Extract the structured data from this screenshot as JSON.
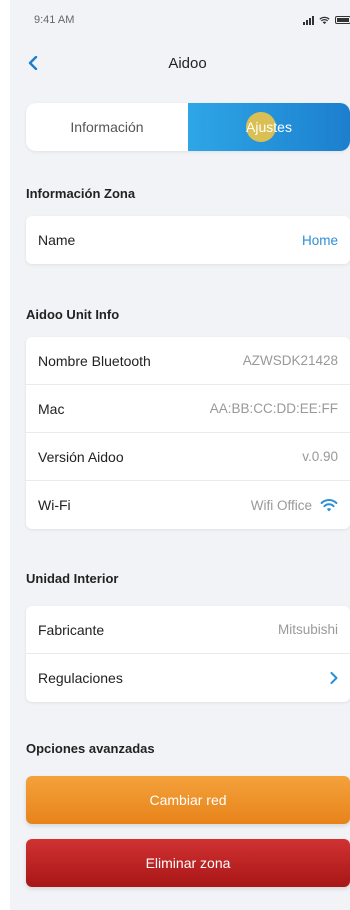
{
  "status_bar": {
    "time": "9:41 AM"
  },
  "nav": {
    "title": "Aidoo"
  },
  "tabs": [
    {
      "label": "Información",
      "active": false
    },
    {
      "label": "Ajustes",
      "active": true
    }
  ],
  "zona": {
    "title": "Información Zona",
    "rows": [
      {
        "label": "Name",
        "value": "Home"
      }
    ]
  },
  "unit": {
    "title": "Aidoo Unit Info",
    "rows": [
      {
        "label": "Nombre Bluetooth",
        "value": "AZWSDK21428"
      },
      {
        "label": "Mac",
        "value": "AA:BB:CC:DD:EE:FF"
      },
      {
        "label": "Versión Aidoo",
        "value": "v.0.90"
      },
      {
        "label": "Wi-Fi",
        "value": "Wifi Office"
      }
    ]
  },
  "interior": {
    "title": "Unidad Interior",
    "rows": [
      {
        "label": "Fabricante",
        "value": "Mitsubishi"
      },
      {
        "label": "Regulaciones",
        "value": ""
      }
    ]
  },
  "advanced": {
    "title": "Opciones avanzadas",
    "change_network": "Cambiar red",
    "delete_zone": "Eliminar zona"
  },
  "colors": {
    "accent": "#2b8fd8",
    "orange": "#e8831a",
    "red": "#b81c1c"
  }
}
